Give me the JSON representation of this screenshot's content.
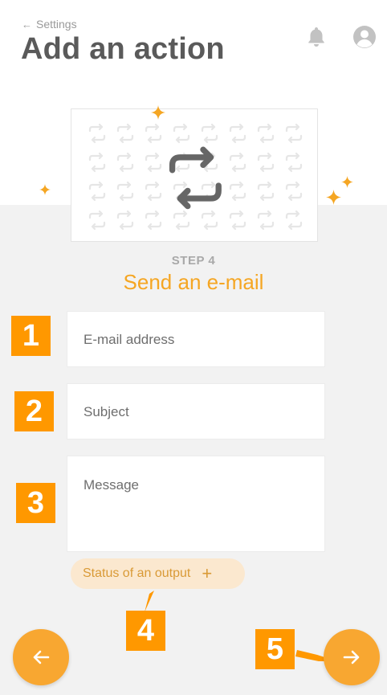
{
  "header": {
    "back_label": "Settings",
    "title": "Add an action",
    "icons": [
      "bell-icon",
      "user-avatar-icon"
    ]
  },
  "illustration": {
    "icon": "repeat-icon",
    "pattern_icon": "repeat-icon"
  },
  "step": {
    "label": "STEP 4",
    "title": "Send an e-mail"
  },
  "form": {
    "email_placeholder": "E-mail address",
    "subject_placeholder": "Subject",
    "message_placeholder": "Message",
    "add_output_label": "Status of an output"
  },
  "annotations": [
    "1",
    "2",
    "3",
    "4",
    "5"
  ],
  "nav": {
    "back_icon": "arrow-left-icon",
    "next_icon": "arrow-right-icon"
  },
  "colors": {
    "accent": "#f5a623",
    "badge": "#ff9800",
    "chip_bg": "#fbe8cf",
    "title": "#5a5a5a",
    "background": "#f2f2f2"
  }
}
